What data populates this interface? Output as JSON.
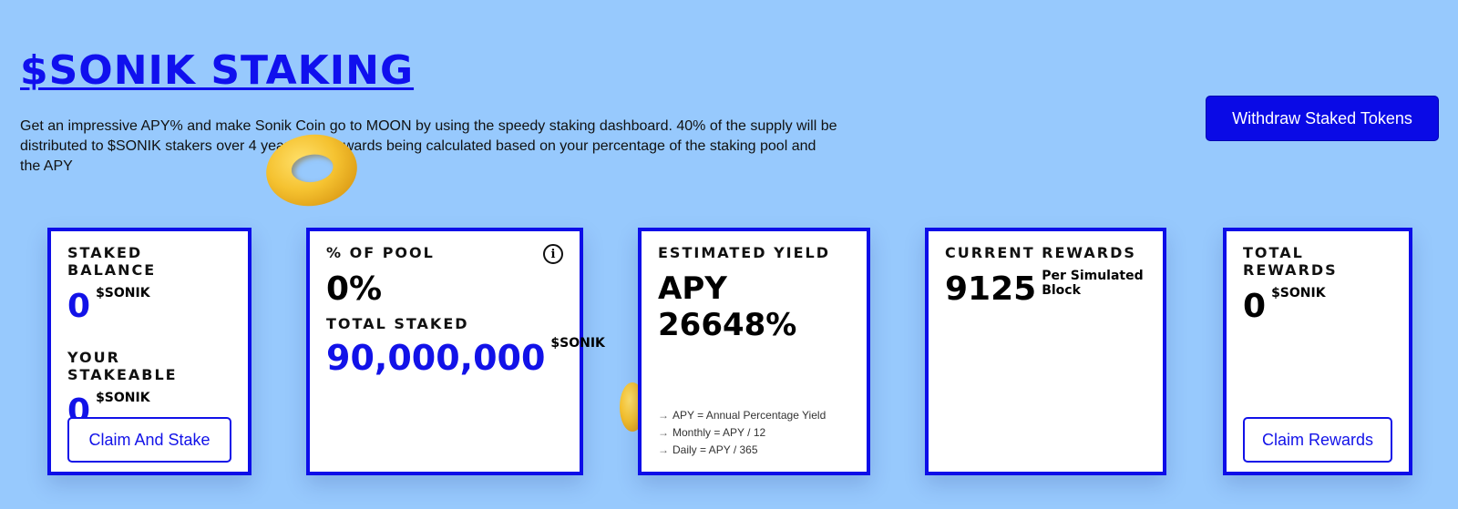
{
  "header": {
    "title": "$SONIK STAKING",
    "description": "Get an impressive APY% and make Sonik Coin go to MOON by using the speedy staking dashboard. 40% of the supply will be distributed to $SONIK stakers over 4 years with rewards being calculated based on your percentage of the staking pool and the APY",
    "withdraw_label": "Withdraw Staked Tokens"
  },
  "cards": {
    "staked": {
      "label": "STAKED BALANCE",
      "value": "0",
      "unit": "$SONIK",
      "stakeable_label": "YOUR STAKEABLE",
      "stakeable_value": "0",
      "stakeable_unit": "$SONIK",
      "button_label": "Claim And Stake"
    },
    "pool": {
      "label": "% OF POOL",
      "value": "0%",
      "total_label": "TOTAL STAKED",
      "total_value": "90,000,000",
      "total_unit": "$SONIK",
      "info_icon": "info-icon"
    },
    "yield": {
      "label": "ESTIMATED YIELD",
      "value": "APY 26648%",
      "notes": [
        {
          "arrow": "→",
          "text": "APY = Annual Percentage Yield"
        },
        {
          "arrow": "→",
          "text": "Monthly = APY / 12"
        },
        {
          "arrow": "→",
          "text": "Daily = APY / 365"
        }
      ]
    },
    "current": {
      "label": "CURRENT REWARDS",
      "value": "9125",
      "unit": "Per Simulated Block"
    },
    "total": {
      "label": "TOTAL REWARDS",
      "value": "0",
      "unit": "$SONIK",
      "button_label": "Claim Rewards"
    }
  },
  "colors": {
    "background": "#97c9fd",
    "accent": "#1212e8",
    "button_bg": "#0a0ae6"
  }
}
